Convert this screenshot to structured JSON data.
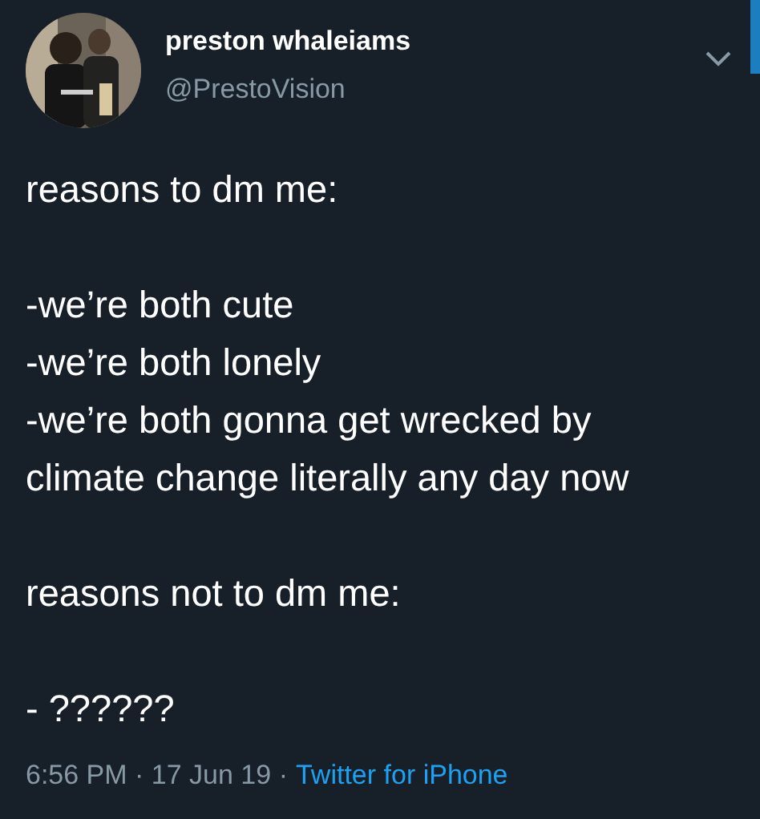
{
  "author": {
    "name": "preston whaleiams",
    "handle": "@PrestoVision"
  },
  "paragraphs": [
    [
      "reasons to dm me:"
    ],
    [
      "-we’re both cute",
      "-we’re both lonely",
      "-we’re both gonna get wrecked by",
      "climate change literally any day now"
    ],
    [
      "reasons not to dm me:"
    ],
    [
      "- ??????"
    ]
  ],
  "meta": {
    "timestamp": "6:56 PM · 17 Jun 19 ·",
    "source": "Twitter for iPhone"
  }
}
